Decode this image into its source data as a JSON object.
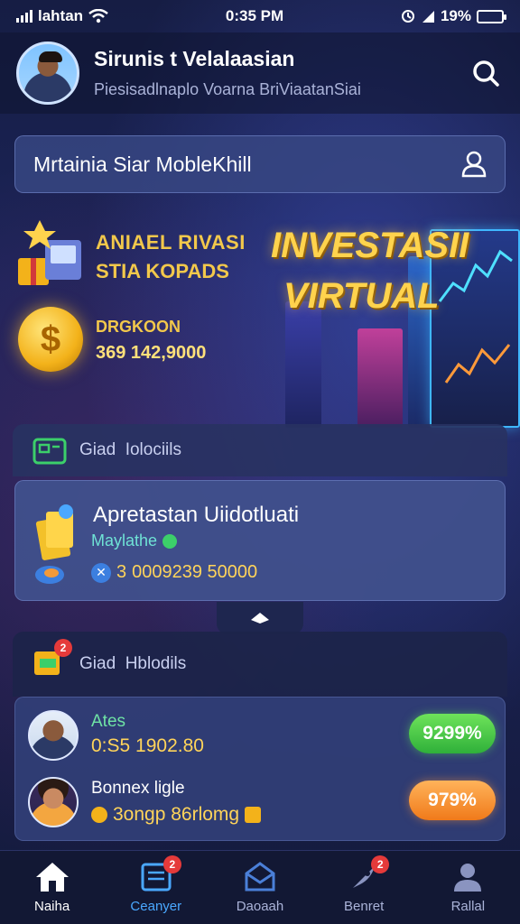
{
  "status_bar": {
    "carrier": "lahtan",
    "time": "0:35 PM",
    "battery": "19%"
  },
  "header": {
    "title": "Sirunis t Velalaasian",
    "subtitle": "Piesisadlnaplo Voarna BriViaatanSiai"
  },
  "title_bar": {
    "text": "Mrtainia Siar MobleKhill"
  },
  "hero": {
    "line1": "ANIAEL RIVASI",
    "line2": "STIA KOPADS",
    "big_title_1": "INVESTASII",
    "big_title_2": "VIRTUAL",
    "coin_label": "DRGKOON",
    "coin_value": "369 142,9000"
  },
  "section1": {
    "label": "Giad  Iolociils"
  },
  "card1": {
    "title": "Apretastan Uiidotluati",
    "subtitle": "Maylathe",
    "value_prefix": "3",
    "value": "0009239 50000"
  },
  "section2": {
    "label": "Giad  Hblodils"
  },
  "rows": [
    {
      "name": "Ates",
      "amount": "0:S5 1902.80",
      "pct": "9299%"
    },
    {
      "name": "Bonnex ligle",
      "amount": "3ongp 86rlomg",
      "pct": "979%"
    }
  ],
  "nav": [
    {
      "label": "Naiha"
    },
    {
      "label": "Ceanyer",
      "badge": "2"
    },
    {
      "label": "Daoaah"
    },
    {
      "label": "Benret",
      "badge": "2"
    },
    {
      "label": "Rallal"
    }
  ],
  "colors": {
    "accent": "#4aa8ff",
    "gold": "#ffd34d",
    "green": "#3ccf6a",
    "orange": "#f07a1a"
  }
}
